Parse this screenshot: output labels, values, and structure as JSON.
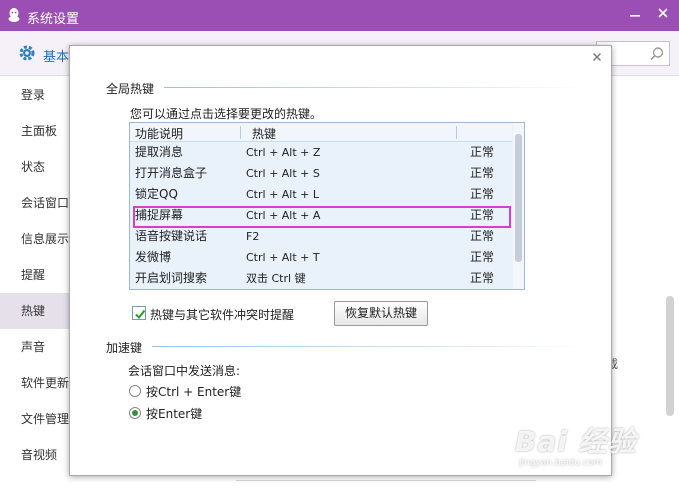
{
  "window": {
    "title": "系统设置",
    "accent_color": "#9b4fb4",
    "minimize_icon": "minimize-icon",
    "close_icon": "close-icon"
  },
  "toolbar": {
    "basic_label": "基本",
    "search_placeholder": ""
  },
  "sidebar": {
    "items": [
      {
        "label": "登录",
        "active": false
      },
      {
        "label": "主面板",
        "active": false
      },
      {
        "label": "状态",
        "active": false
      },
      {
        "label": "会话窗口",
        "active": false
      },
      {
        "label": "信息展示",
        "active": false
      },
      {
        "label": "提醒",
        "active": false
      },
      {
        "label": "热键",
        "active": true
      },
      {
        "label": "声音",
        "active": false
      },
      {
        "label": "软件更新",
        "active": false
      },
      {
        "label": "文件管理",
        "active": false
      },
      {
        "label": "音视频",
        "active": false
      }
    ]
  },
  "background": {
    "fragment": "载"
  },
  "dialog": {
    "global_hotkeys_title": "全局热键",
    "hint": "您可以通过点击选择要更改的热键。",
    "table": {
      "headers": [
        "功能说明",
        "热键"
      ],
      "rows": [
        {
          "name": "提取消息",
          "key": "Ctrl + Alt + Z",
          "status": "正常"
        },
        {
          "name": "打开消息盒子",
          "key": "Ctrl + Alt + S",
          "status": "正常"
        },
        {
          "name": "锁定QQ",
          "key": "Ctrl + Alt + L",
          "status": "正常"
        },
        {
          "name": "捕捉屏幕",
          "key": "Ctrl + Alt + A",
          "status": "正常"
        },
        {
          "name": "语音按键说话",
          "key": "F2",
          "status": "正常"
        },
        {
          "name": "发微博",
          "key": "Ctrl + Alt + T",
          "status": "正常"
        },
        {
          "name": "开启划词搜索",
          "key": "双击 Ctrl 键",
          "status": "正常"
        }
      ],
      "highlighted_row": 3,
      "highlight_color": "#d63fc8"
    },
    "conflict_checkbox": {
      "label": "热键与其它软件冲突时提醒",
      "checked": true
    },
    "restore_button": "恢复默认热键",
    "accelerator_title": "加速键",
    "send_label": "会话窗口中发送消息:",
    "send_options": [
      {
        "label": "按Ctrl + Enter键",
        "checked": false
      },
      {
        "label": "按Enter键",
        "checked": true
      }
    ]
  },
  "watermark": {
    "main": "Bai 经验",
    "sub": "jingyan.baidu.com"
  }
}
